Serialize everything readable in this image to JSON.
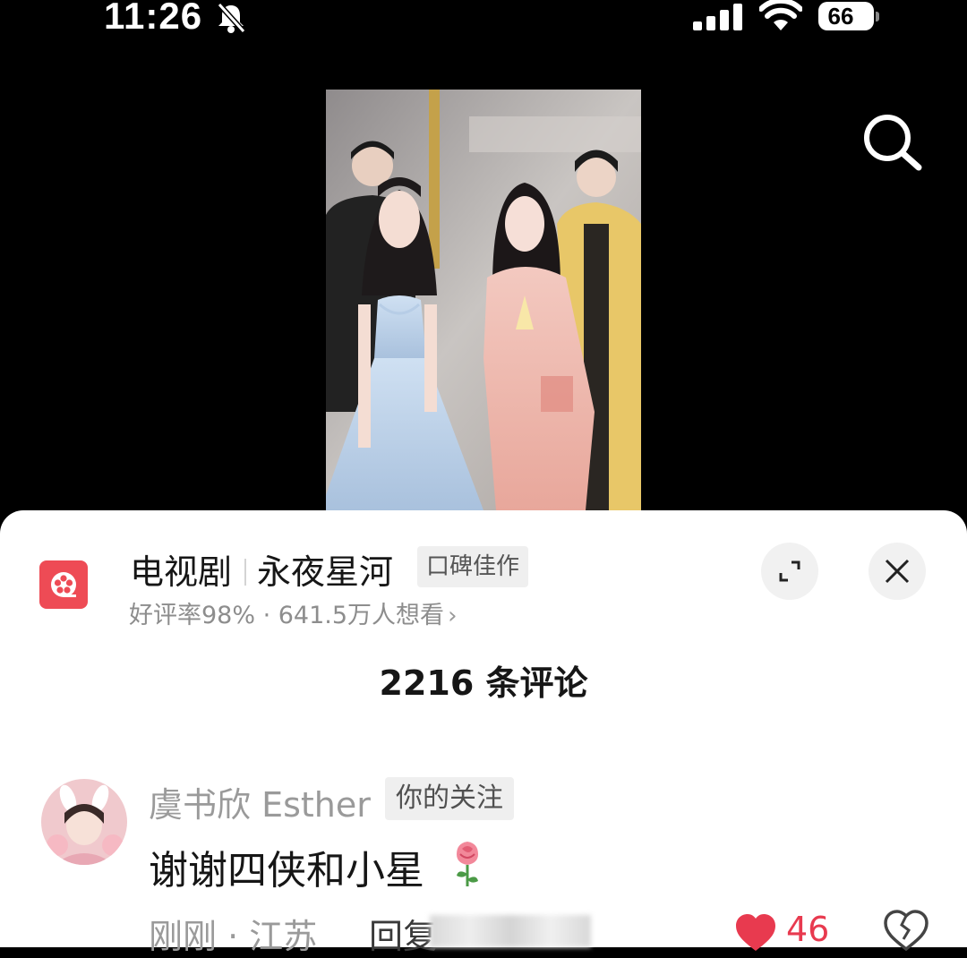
{
  "status_bar": {
    "time": "11:26",
    "battery": "66",
    "icons": [
      "bell-slash-icon",
      "signal-icon",
      "wifi-icon",
      "battery-icon"
    ]
  },
  "video": {
    "search_icon": "search-icon"
  },
  "sheet": {
    "show": {
      "category": "电视剧",
      "title": "永夜星河",
      "badge": "口碑佳作",
      "meta": "好评率98% · 641.5万人想看",
      "chevron": "›",
      "icon": "film-reel-icon"
    },
    "comment_count": "2216 条评论",
    "comment": {
      "username": "虞书欣 Esther",
      "follow_badge": "你的关注",
      "text": "谢谢四侠和小星",
      "emoji": "rose-icon",
      "time_location": "刚刚 · 江苏",
      "reply_label": "回复",
      "like_count": "46"
    }
  },
  "colors": {
    "accent_red": "#e83a4f",
    "show_icon_bg": "#ee4b55",
    "sheet_bg": "#ffffff",
    "page_bg": "#000000"
  }
}
